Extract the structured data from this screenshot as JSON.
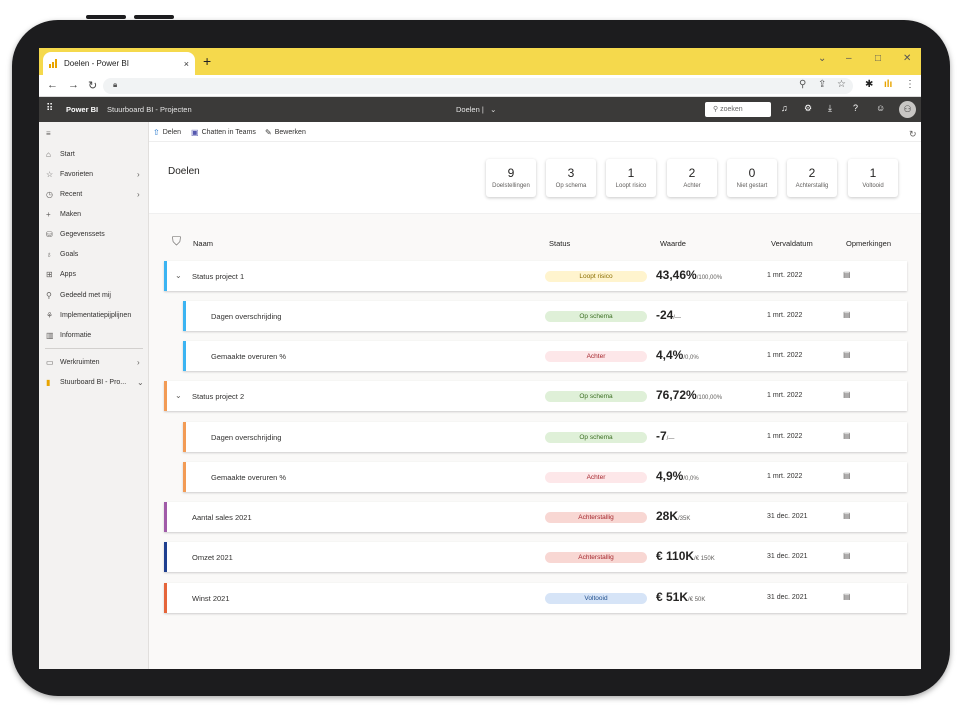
{
  "browser": {
    "tab_title": "Doelen - Power BI",
    "tab_close": "×",
    "new_tab": "+",
    "controls": [
      "⌄",
      "–",
      "□",
      "✕"
    ]
  },
  "app": {
    "brand": "Power BI",
    "breadcrumb": "Stuurboard BI - Projecten",
    "center_title": "Doelen |",
    "center_chevron": "⌄",
    "search_placeholder": "zoeken"
  },
  "nav": {
    "items": [
      {
        "label": "Start",
        "icon": "⌂",
        "chev": ""
      },
      {
        "label": "Favorieten",
        "icon": "☆",
        "chev": "›"
      },
      {
        "label": "Recent",
        "icon": "◷",
        "chev": "›"
      },
      {
        "label": "Maken",
        "icon": "+",
        "chev": ""
      },
      {
        "label": "Gegevenssets",
        "icon": "⛁",
        "chev": ""
      },
      {
        "label": "Goals",
        "icon": "♁",
        "chev": ""
      },
      {
        "label": "Apps",
        "icon": "⊞",
        "chev": ""
      },
      {
        "label": "Gedeeld met mij",
        "icon": "⚲",
        "chev": ""
      },
      {
        "label": "Implementatiepijplijnen",
        "icon": "⚘",
        "chev": ""
      },
      {
        "label": "Informatie",
        "icon": "▥",
        "chev": ""
      }
    ],
    "workspaces": {
      "label": "Werkruimten",
      "icon": "▭",
      "chev": "›"
    },
    "current": {
      "label": "Stuurboard BI - Pro...",
      "icon": "▮",
      "chev": "⌄"
    }
  },
  "actions": {
    "share": "Delen",
    "teams": "Chatten in Teams",
    "edit": "Bewerken"
  },
  "goals": {
    "title": "Doelen",
    "stats": [
      {
        "value": "9",
        "label": "Doelstellingen"
      },
      {
        "value": "3",
        "label": "Op schema"
      },
      {
        "value": "1",
        "label": "Loopt risico"
      },
      {
        "value": "2",
        "label": "Achter"
      },
      {
        "value": "0",
        "label": "Niet gestart"
      },
      {
        "value": "2",
        "label": "Achterstallig"
      },
      {
        "value": "1",
        "label": "Voltooid"
      }
    ]
  },
  "columns": {
    "name": "Naam",
    "status": "Status",
    "value": "Waarde",
    "due": "Vervaldatum",
    "notes": "Opmerkingen"
  },
  "rows": [
    {
      "name": "Status project 1",
      "chev": "⌄",
      "status": "Loopt risico",
      "status_type": "risk",
      "value": "43,46%",
      "target": "/100,00%",
      "due": "1 mrt. 2022",
      "accent": "#3bb4f2",
      "child": false
    },
    {
      "name": "Dagen overschrijding",
      "chev": "",
      "status": "Op schema",
      "status_type": "ok",
      "value": "-24",
      "target": "/—",
      "due": "1 mrt. 2022",
      "accent": "#3bb4f2",
      "child": true
    },
    {
      "name": "Gemaakte overuren %",
      "chev": "",
      "status": "Achter",
      "status_type": "behind",
      "value": "4,4%",
      "target": "/0,0%",
      "due": "1 mrt. 2022",
      "accent": "#3bb4f2",
      "child": true
    },
    {
      "name": "Status project 2",
      "chev": "⌄",
      "status": "Op schema",
      "status_type": "ok",
      "value": "76,72%",
      "target": "/100,00%",
      "due": "1 mrt. 2022",
      "accent": "#f29b55",
      "child": false
    },
    {
      "name": "Dagen overschrijding",
      "chev": "",
      "status": "Op schema",
      "status_type": "ok",
      "value": "-7",
      "target": "/—",
      "due": "1 mrt. 2022",
      "accent": "#f29b55",
      "child": true
    },
    {
      "name": "Gemaakte overuren %",
      "chev": "",
      "status": "Achter",
      "status_type": "behind",
      "value": "4,9%",
      "target": "/0,0%",
      "due": "1 mrt. 2022",
      "accent": "#f29b55",
      "child": true
    },
    {
      "name": "Aantal sales 2021",
      "chev": "",
      "status": "Achterstallig",
      "status_type": "overdue",
      "value": "28K",
      "target": "/35K",
      "due": "31 dec. 2021",
      "accent": "#a05ba8",
      "child": false
    },
    {
      "name": "Omzet 2021",
      "chev": "",
      "status": "Achterstallig",
      "status_type": "overdue",
      "value": "€ 110K",
      "target": "/€ 150K",
      "due": "31 dec. 2021",
      "accent": "#1f3f8f",
      "child": false
    },
    {
      "name": "Winst 2021",
      "chev": "",
      "status": "Voltooid",
      "status_type": "done",
      "value": "€ 51K",
      "target": "/€ 50K",
      "due": "31 dec. 2021",
      "accent": "#e5653a",
      "child": false
    }
  ],
  "colors": {
    "tabbar": "#f5d94c",
    "pbi_header": "#3b3a39",
    "risk": "#fff4ce",
    "ok": "#dff0d8",
    "behind": "#fde7e9",
    "overdue": "#f8d7d3",
    "done": "#d6e4f7"
  }
}
